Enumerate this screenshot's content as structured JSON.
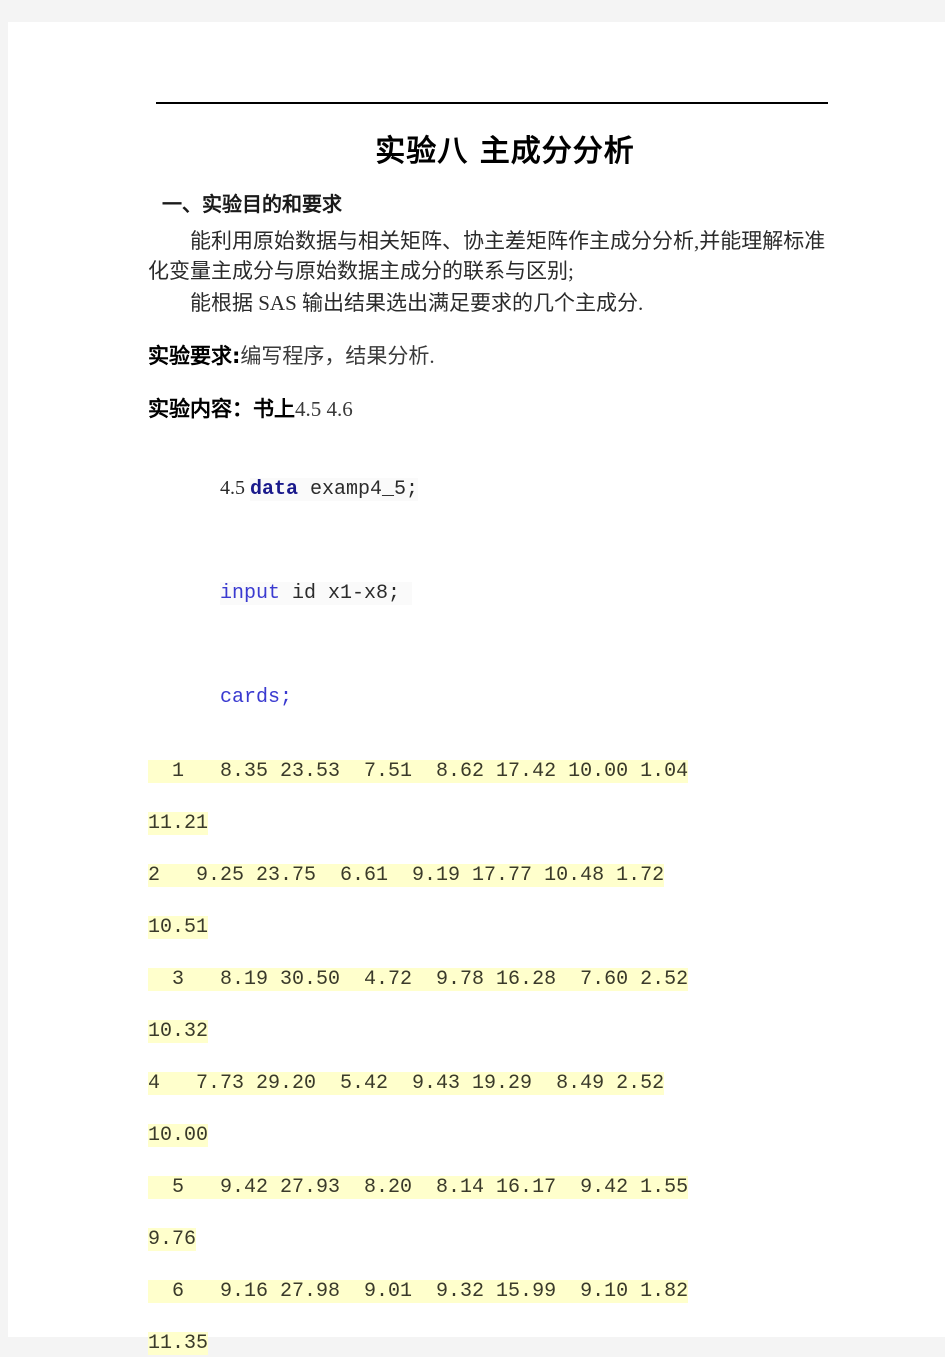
{
  "document": {
    "title": "实验八  主成分分析",
    "sections": [
      {
        "heading": "一、实验目的和要求",
        "paragraphs": [
          "能利用原始数据与相关矩阵、协主差矩阵作主成分分析,并能理解标准化变量主成分与原始数据主成分的联系与区别;",
          "能根据 SAS 输出结果选出满足要求的几个主成分."
        ]
      }
    ],
    "labeled_lines": [
      {
        "label": "实验要求:",
        "value": "编写程序，结果分析."
      },
      {
        "label": "实验内容：书上",
        "value": "4.5  4.6"
      }
    ],
    "code": {
      "data_statement": {
        "prefix": "4.5 ",
        "keyword": "data",
        "rest": " examp4_5;"
      },
      "input_statement": {
        "keyword": "input",
        "rest": " id x1-x8; "
      },
      "cards_statement": {
        "keyword": "cards;"
      }
    },
    "data_rows": [
      {
        "line1": "  1   8.35 23.53  7.51  8.62 17.42 10.00 1.04",
        "line2": "11.21"
      },
      {
        "line1": "2   9.25 23.75  6.61  9.19 17.77 10.48 1.72",
        "line2": "10.51"
      },
      {
        "line1": "  3   8.19 30.50  4.72  9.78 16.28  7.60 2.52",
        "line2": "10.32"
      },
      {
        "line1": "4   7.73 29.20  5.42  9.43 19.29  8.49 2.52",
        "line2": "10.00"
      },
      {
        "line1": "  5   9.42 27.93  8.20  8.14 16.17  9.42 1.55",
        "line2": "9.76"
      },
      {
        "line1": "  6   9.16 27.98  9.01  9.32 15.99  9.10 1.82",
        "line2": "11.35"
      }
    ],
    "colors": {
      "highlight": "#ffffcc",
      "keyword_blue": "#3a3ad0",
      "keyword_bold_blue": "#1a1a8c",
      "page_background": "#ffffff",
      "outer_background": "#f4f4f4"
    }
  }
}
